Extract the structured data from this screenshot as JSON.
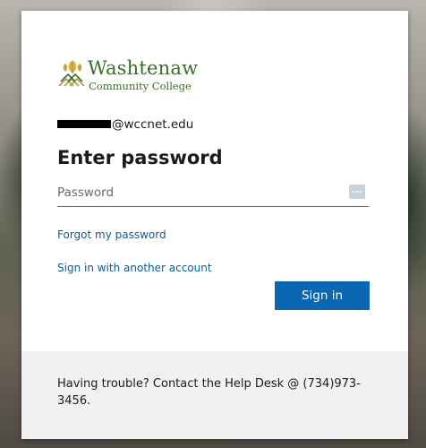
{
  "branding": {
    "org_name": "Washtenaw",
    "org_sub": "Community College",
    "logo_icon": "wcc-leaf-logo-icon",
    "brand_color": "#3c6b2c"
  },
  "account": {
    "email_suffix": "@wccnet.edu"
  },
  "page": {
    "title": "Enter password"
  },
  "password_field": {
    "value": "",
    "placeholder": "Password",
    "reveal_icon": "ellipsis-icon"
  },
  "links": {
    "forgot_password": "Forgot my password",
    "other_account": "Sign in with another account"
  },
  "buttons": {
    "sign_in": "Sign in",
    "sign_in_color": "#0b67b2"
  },
  "footer": {
    "help_text": "Having trouble? Contact the Help Desk @ (734)973-3456."
  }
}
